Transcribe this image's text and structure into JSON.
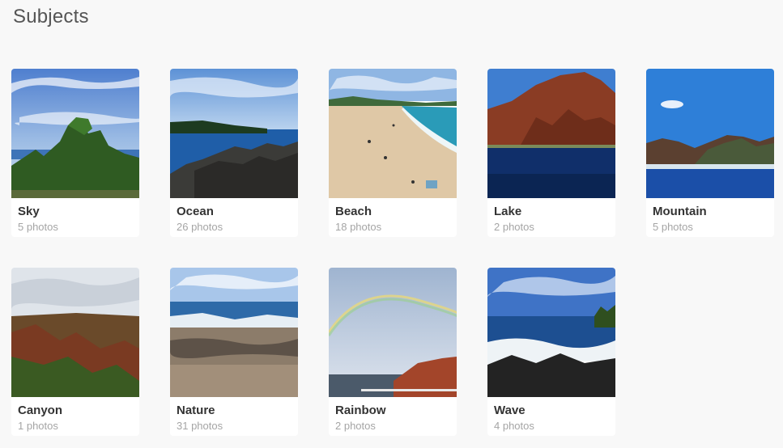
{
  "page": {
    "title": "Subjects"
  },
  "subjects": [
    {
      "name": "Sky",
      "count": "5 photos"
    },
    {
      "name": "Ocean",
      "count": "26 photos"
    },
    {
      "name": "Beach",
      "count": "18 photos"
    },
    {
      "name": "Lake",
      "count": "2 photos"
    },
    {
      "name": "Mountain",
      "count": "5 photos"
    },
    {
      "name": "Canyon",
      "count": "1 photos"
    },
    {
      "name": "Nature",
      "count": "31 photos"
    },
    {
      "name": "Rainbow",
      "count": "2 photos"
    },
    {
      "name": "Wave",
      "count": "4 photos"
    }
  ],
  "colors": {
    "background": "#f8f8f8",
    "card": "#ffffff",
    "title_text": "#555555",
    "name_text": "#333333",
    "count_text": "#a5a5a5"
  }
}
